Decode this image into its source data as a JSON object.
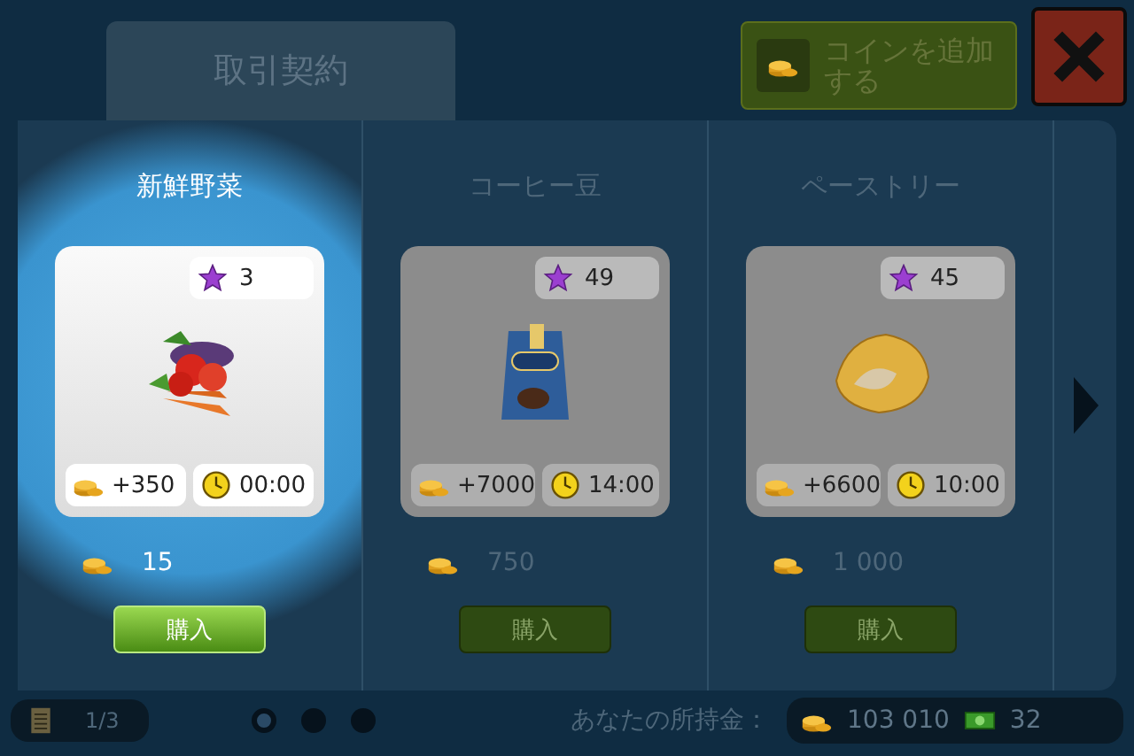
{
  "tab": {
    "label": "取引契約"
  },
  "add_coins_button": {
    "label": "コインを追加する"
  },
  "items": [
    {
      "title": "新鮮野菜",
      "kind": "vegetables",
      "highlighted": true,
      "level_req": "3",
      "income": "+350",
      "time": "00:00",
      "price": "15",
      "buy_label": "購入"
    },
    {
      "title": "コーヒー豆",
      "kind": "coffee",
      "highlighted": false,
      "level_req": "49",
      "income": "+7000",
      "time": "14:00",
      "price": "750",
      "buy_label": "購入"
    },
    {
      "title": "ペーストリー",
      "kind": "pastry",
      "highlighted": false,
      "level_req": "45",
      "income": "+6600",
      "time": "10:00",
      "price": "1 000",
      "buy_label": "購入"
    }
  ],
  "footer": {
    "page": "1/3",
    "pager": [
      {
        "selected": true
      },
      {
        "selected": false
      },
      {
        "selected": false
      }
    ],
    "balance_label": "あなたの所持金：",
    "coins": "103 010",
    "cash": "32"
  }
}
